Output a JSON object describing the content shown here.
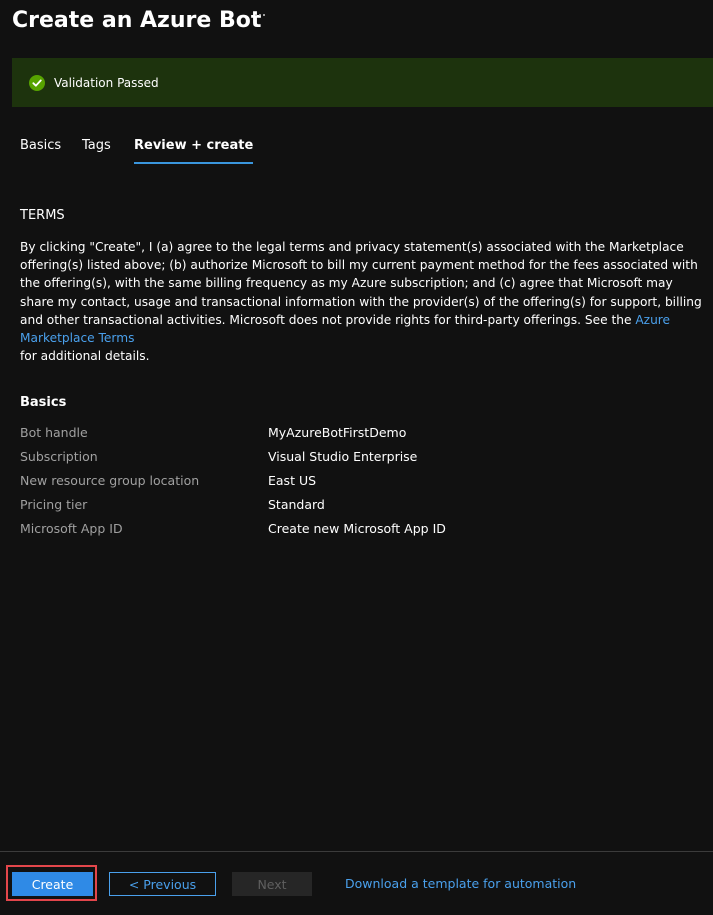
{
  "header": {
    "title": "Create an Azure Bot",
    "more_icon": "more-ellipsis-icon"
  },
  "validation": {
    "text": "Validation Passed",
    "icon": "check-circle-icon",
    "status_color": "#57a300"
  },
  "tabs": [
    {
      "label": "Basics",
      "active": false
    },
    {
      "label": "Tags",
      "active": false
    },
    {
      "label": "Review + create",
      "active": true
    }
  ],
  "terms": {
    "heading": "TERMS",
    "body": "By clicking \"Create\", I (a) agree to the legal terms and privacy statement(s) associated with the Marketplace offering(s) listed above; (b) authorize Microsoft to bill my current payment method for the fees associated with the offering(s), with the same billing frequency as my Azure subscription; and (c) agree that Microsoft may share my contact, usage and transactional information with the provider(s) of the offering(s) for support, billing and other transactional activities. Microsoft does not provide rights for third-party offerings. See the",
    "link_text": "Azure Marketplace Terms",
    "suffix": "for additional details."
  },
  "basics": {
    "heading": "Basics",
    "rows": [
      {
        "label": "Bot handle",
        "value": "MyAzureBotFirstDemo"
      },
      {
        "label": "Subscription",
        "value": "Visual Studio Enterprise"
      },
      {
        "label": "New resource group location",
        "value": "East US"
      },
      {
        "label": "Pricing tier",
        "value": "Standard"
      },
      {
        "label": "Microsoft App ID",
        "value": "Create new Microsoft App ID"
      }
    ]
  },
  "footer": {
    "create_label": "Create",
    "previous_label": "< Previous",
    "next_label": "Next",
    "download_link": "Download a template for automation"
  },
  "colors": {
    "background": "#111111",
    "banner": "#1d330d",
    "accent": "#2f8ae6",
    "link": "#4aa0ec",
    "highlight": "#e3464b"
  }
}
